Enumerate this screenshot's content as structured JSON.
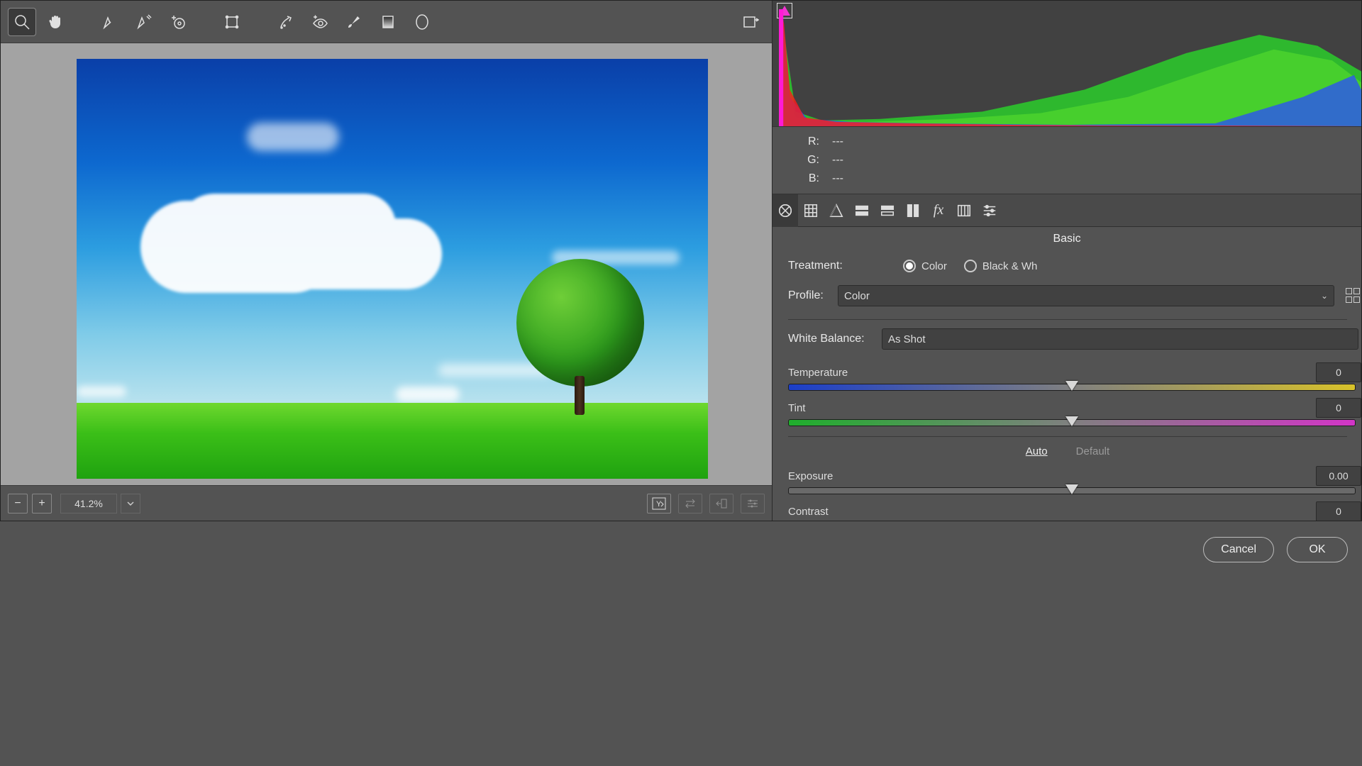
{
  "toolbar": {
    "zoom_active": true
  },
  "bottombar": {
    "zoom": "41.2%"
  },
  "rgb": {
    "r_label": "R:",
    "r_val": "---",
    "g_label": "G:",
    "g_val": "---",
    "b_label": "B:",
    "b_val": "---"
  },
  "panel": {
    "title": "Basic",
    "treatment_label": "Treatment:",
    "treatment_options": {
      "color": "Color",
      "bw": "Black & Wh"
    },
    "profile_label": "Profile:",
    "profile_value": "Color",
    "wb_label": "White Balance:",
    "wb_value": "As Shot",
    "temperature_label": "Temperature",
    "temperature_value": "0",
    "tint_label": "Tint",
    "tint_value": "0",
    "auto": "Auto",
    "default": "Default",
    "exposure_label": "Exposure",
    "exposure_value": "0.00",
    "contrast_label": "Contrast",
    "contrast_value": "0"
  },
  "footer": {
    "cancel": "Cancel",
    "ok": "OK"
  }
}
